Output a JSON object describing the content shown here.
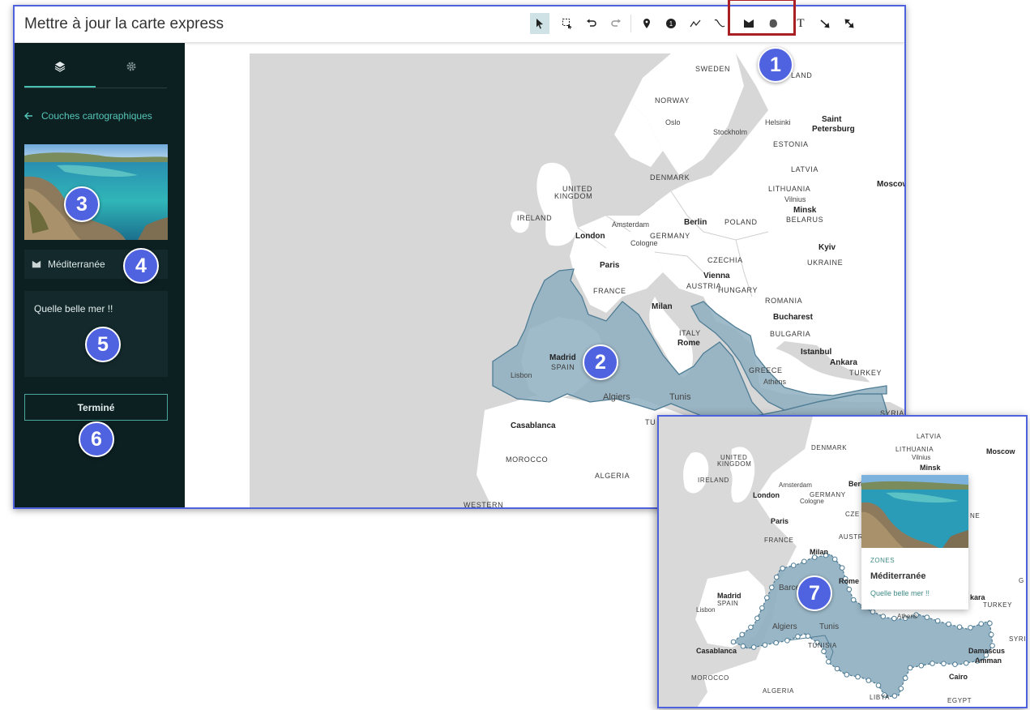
{
  "app": {
    "title": "Mettre à jour la carte express"
  },
  "toolbar": {
    "tools": [
      {
        "name": "select",
        "icon": "pointer-icon"
      },
      {
        "name": "select-box",
        "icon": "selection-box-icon"
      },
      {
        "name": "undo",
        "icon": "undo-icon"
      },
      {
        "name": "redo",
        "icon": "redo-icon"
      },
      {
        "name": "pin",
        "icon": "pin-icon"
      },
      {
        "name": "marker-number",
        "icon": "numbered-marker-icon"
      },
      {
        "name": "line",
        "icon": "line-icon"
      },
      {
        "name": "freehand-line",
        "icon": "freehand-line-icon"
      },
      {
        "name": "polygon",
        "icon": "polygon-icon"
      },
      {
        "name": "freehand-area",
        "icon": "freehand-area-icon"
      },
      {
        "name": "text",
        "icon": "text-icon"
      },
      {
        "name": "arrow",
        "icon": "arrow-icon"
      },
      {
        "name": "double-arrow",
        "icon": "double-arrow-icon"
      }
    ],
    "text_tool_label": "T"
  },
  "sidebar": {
    "tabs": [
      {
        "name": "layers",
        "icon": "layers-icon"
      },
      {
        "name": "settings",
        "icon": "gear-icon"
      }
    ],
    "back_label": "Couches cartographiques",
    "back_icon": "arrow-left-icon",
    "item_title": "Méditerranée",
    "item_icon": "polygon-icon",
    "description": "Quelle belle mer !!",
    "done_label": "Terminé"
  },
  "map": {
    "labels": [
      "SWEDEN",
      "NORWAY",
      "Oslo",
      "Stockholm",
      "Helsinki",
      "Saint",
      "Petersburg",
      "ESTONIA",
      "LATVIA",
      "LITHUANIA",
      "Vilnius",
      "Minsk",
      "BELARUS",
      "Moscow",
      "DENMARK",
      "UNITED",
      "KINGDOM",
      "IRELAND",
      "Amsterdam",
      "Berlin",
      "POLAND",
      "London",
      "GERMANY",
      "Cologne",
      "Kyiv",
      "UKRAINE",
      "CZECHIA",
      "Paris",
      "Vienna",
      "AUSTRIA",
      "HUNGARY",
      "FRANCE",
      "ROMANIA",
      "Milan",
      "Bucharest",
      "BULGARIA",
      "ITALY",
      "Rome",
      "Istanbul",
      "Madrid",
      "SPAIN",
      "Lisbon",
      "GREECE",
      "Athens",
      "Ankara",
      "TURKEY",
      "Algiers",
      "Tunis",
      "Casablanca",
      "MOROCCO",
      "ALGERIA",
      "SYRIA",
      "WESTERN",
      "TU",
      "LAND"
    ]
  },
  "inset": {
    "popup": {
      "layer": "ZONES",
      "title": "Méditerranée",
      "description": "Quelle belle mer !!"
    },
    "labels": [
      "LATVIA",
      "Moscow",
      "DENMARK",
      "LITHUANIA",
      "Vilnius",
      "Minsk",
      "UNITED",
      "KINGDOM",
      "IRELAND",
      "Berlin",
      "Amsterdam",
      "London",
      "GERMANY",
      "Cologne",
      "Paris",
      "FRANCE",
      "Milan",
      "Madrid",
      "SPAIN",
      "Lisbon",
      "Algiers",
      "Tunis",
      "Casablanca",
      "MOROCCO",
      "ALGERIA",
      "LIBYA",
      "EGYPT",
      "Cairo",
      "Damascus",
      "Amman",
      "SYRIA",
      "TURKEY",
      "kara",
      "Athens",
      "TUNISIA",
      "Barcelona",
      "CZE",
      "AUSTR",
      "Rome",
      "NE",
      "G"
    ]
  },
  "badges": [
    "1",
    "2",
    "3",
    "4",
    "5",
    "6",
    "7"
  ],
  "colors": {
    "accent": "#4f63e0",
    "sidebar_bg": "#0c1f21",
    "teal": "#55c7b8",
    "zone_fill": "#8eaec0",
    "highlight": "#a91f24"
  }
}
